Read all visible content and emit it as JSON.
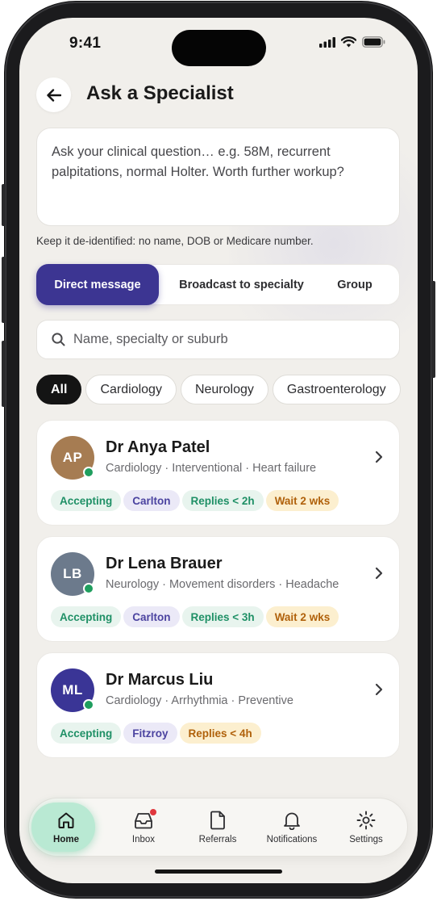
{
  "status": {
    "time": "9:41"
  },
  "header": {
    "title": "Ask a Specialist"
  },
  "question": {
    "placeholder": "Ask your clinical question… e.g. 58M, recurrent palpitations, normal Holter. Worth further workup?"
  },
  "deid_note": "Keep it de-identified: no name, DOB or Medicare number.",
  "segments": [
    "Direct message",
    "Broadcast to specialty",
    "Group"
  ],
  "search": {
    "placeholder": "Name, specialty or suburb"
  },
  "filters": [
    "All",
    "Cardiology",
    "Neurology",
    "Gastroenterology"
  ],
  "specialists": [
    {
      "initials": "AP",
      "name": "Dr Anya Patel",
      "subtitle": "Cardiology · Interventional · Heart failure",
      "avatar_color": "#a67c52",
      "tags": [
        {
          "text": "Accepting",
          "tone": "green"
        },
        {
          "text": "Carlton",
          "tone": "purple"
        },
        {
          "text": "Replies < 2h",
          "tone": "green"
        },
        {
          "text": "Wait 2 wks",
          "tone": "amber"
        }
      ]
    },
    {
      "initials": "LB",
      "name": "Dr Lena Brauer",
      "subtitle": "Neurology · Movement disorders · Headache",
      "avatar_color": "#6c7a8c",
      "tags": [
        {
          "text": "Accepting",
          "tone": "green"
        },
        {
          "text": "Carlton",
          "tone": "purple"
        },
        {
          "text": "Replies < 3h",
          "tone": "green"
        },
        {
          "text": "Wait 2 wks",
          "tone": "amber"
        }
      ]
    },
    {
      "initials": "ML",
      "name": "Dr Marcus Liu",
      "subtitle": "Cardiology · Arrhythmia · Preventive",
      "avatar_color": "#3a3596",
      "tags": [
        {
          "text": "Accepting",
          "tone": "green"
        },
        {
          "text": "Fitzroy",
          "tone": "purple"
        },
        {
          "text": "Replies < 4h",
          "tone": "amber"
        }
      ]
    }
  ],
  "nav": [
    {
      "label": "Home",
      "icon": "home-icon",
      "active": true
    },
    {
      "label": "Inbox",
      "icon": "inbox-icon",
      "badge": true
    },
    {
      "label": "Referrals",
      "icon": "document-icon"
    },
    {
      "label": "Notifications",
      "icon": "bell-icon"
    },
    {
      "label": "Settings",
      "icon": "gear-icon"
    }
  ],
  "colors": {
    "accent": "#3c3592",
    "online": "#1f9e5e",
    "nav_active": "#b9e9d3",
    "badge": "#e0383e"
  }
}
